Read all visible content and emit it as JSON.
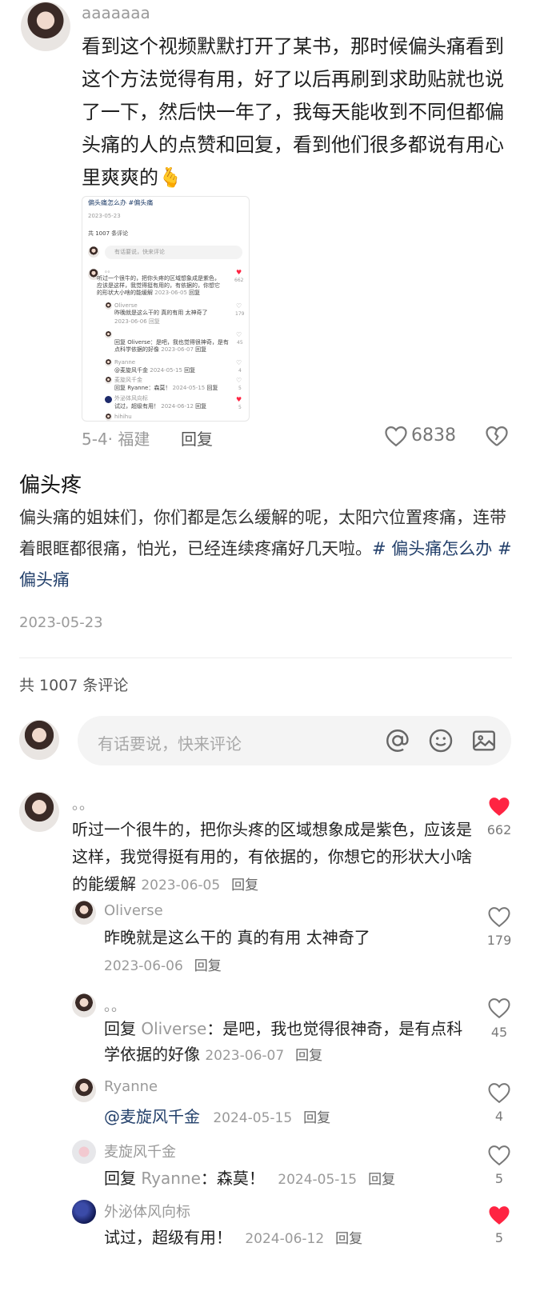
{
  "top_comment": {
    "username": "aaaaaaa",
    "text": "看到这个视频默默打开了某书，那时候偏头痛看到这个方法觉得有用，好了以后再刷到求助贴就也说了一下，然后快一年了，我每天能收到不同但都偏头痛的人的点赞和回复，看到他们很多都说有用心里爽爽的",
    "emoji": "🫰",
    "meta": "5-4· 福建",
    "reply_label": "回复",
    "like_count": "6838"
  },
  "screenshot_thumb": {
    "title": "偏头痛怎么办 #偏头痛",
    "date": "2023-05-23",
    "count": "共 1007 条评论",
    "input_placeholder": "有话要说，快来评论",
    "c1_name": "。。",
    "c1_text_1": "听过一个很牛的，把你头疼的区域想象成是紫色，",
    "c1_text_2": "应该是这样，我觉得挺有用的，有依据的，你想它",
    "c1_text_3": "的形状大小啥的能缓解",
    "c1_date": "2023-06-05",
    "c1_likes": "662",
    "r1_name": "Oliverse",
    "r1_text": "昨晚就是这么干的 真的有用 太神奇了",
    "r1_date": "2023-06-06",
    "r1_likes": "179",
    "r2_text_1": "回复 Oliverse：是吧，我也觉得很神奇，是有",
    "r2_text_2": "点科学依据的好像",
    "r2_date": "2023-06-07",
    "r2_likes": "45",
    "r3_name": "Ryanne",
    "r3_text": "@麦旋风千金",
    "r3_date": "2024-05-15",
    "r3_likes": "4",
    "r4_name": "麦旋风千金",
    "r4_text": "回复 Ryanne：森莫！",
    "r4_date": "2024-05-15",
    "r4_likes": "5",
    "r5_name": "外泌体风向标",
    "r5_text": "试过，超级有用！",
    "r5_date": "2024-06-12",
    "r5_likes": "5",
    "r6_name": "hihihu",
    "reply_label": "回复"
  },
  "post": {
    "title": "偏头疼",
    "body": "偏头痛的姐妹们，你们都是怎么缓解的呢，太阳穴位置疼痛，连带着眼眶都很痛，怕光，已经连续疼痛好几天啦。",
    "tags": "# 偏头痛怎么办 #偏头痛",
    "date": "2023-05-23"
  },
  "comments_header": {
    "count_label": "共 1007 条评论"
  },
  "comment_input": {
    "placeholder": "有话要说，快来评论"
  },
  "comments": {
    "c1": {
      "name": "。。",
      "text": "听过一个很牛的，把你头疼的区域想象成是紫色，应该是这样，我觉得挺有用的，有依据的，你想它的形状大小啥的能缓解",
      "date": "2023-06-05",
      "reply": "回复",
      "likes": "662"
    },
    "r1": {
      "name": "Oliverse",
      "text": "昨晚就是这么干的 真的有用 太神奇了",
      "date": "2023-06-06",
      "reply": "回复",
      "likes": "179"
    },
    "r2": {
      "name": "。。",
      "prefix": "回复 ",
      "target": "Oliverse",
      "text": "：是吧，我也觉得很神奇，是有点科学依据的好像",
      "date": "2023-06-07",
      "reply": "回复",
      "likes": "45"
    },
    "r3": {
      "name": "Ryanne",
      "text": "@麦旋风千金",
      "date": "2024-05-15",
      "reply": "回复",
      "likes": "4"
    },
    "r4": {
      "name": "麦旋风千金",
      "prefix": "回复 ",
      "target": "Ryanne",
      "text": "：森莫！",
      "date": "2024-05-15",
      "reply": "回复",
      "likes": "5"
    },
    "r5": {
      "name": "外泌体风向标",
      "text": "试过，超级有用！",
      "date": "2024-06-12",
      "reply": "回复",
      "likes": "5"
    }
  },
  "colors": {
    "liked": "#ff2442",
    "tag": "#23406b",
    "muted": "#9a9a9a"
  },
  "icons": [
    "heart-outline-icon",
    "heart-filled-icon",
    "broken-heart-icon",
    "at-icon",
    "smile-icon",
    "image-icon"
  ]
}
